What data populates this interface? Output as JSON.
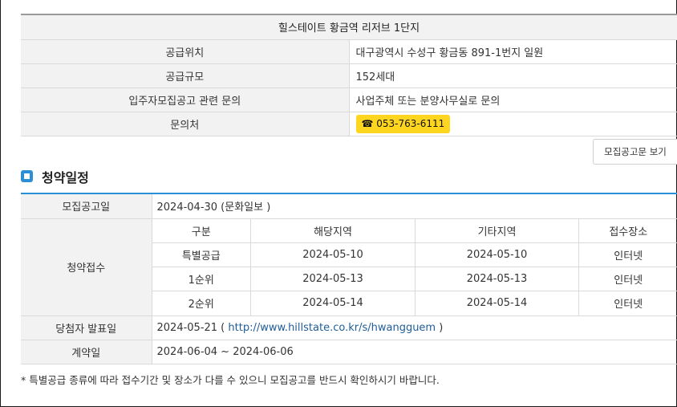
{
  "complex": {
    "title": "힐스테이트 황금역 리저브 1단지",
    "rows": [
      {
        "label": "공급위치",
        "value": "대구광역시 수성구 황금동 891-1번지 일원"
      },
      {
        "label": "공급규모",
        "value": "152세대"
      },
      {
        "label": "입주자모집공고 관련 문의",
        "value": "사업주체 또는 분양사무실로 문의"
      }
    ],
    "contact_label": "문의처",
    "phone": "☎ 053-763-6111"
  },
  "notice_button": "모집공고문 보기",
  "schedule": {
    "section_title": "청약일정",
    "announce_label": "모집공고일",
    "announce_value": "2024-04-30 (문화일보 )",
    "apply_label": "청약접수",
    "columns": [
      "구분",
      "해당지역",
      "기타지역",
      "접수장소"
    ],
    "rows": [
      [
        "특별공급",
        "2024-05-10",
        "2024-05-10",
        "인터넷"
      ],
      [
        "1순위",
        "2024-05-13",
        "2024-05-13",
        "인터넷"
      ],
      [
        "2순위",
        "2024-05-14",
        "2024-05-14",
        "인터넷"
      ]
    ],
    "winner_label": "당첨자 발표일",
    "winner_date": "2024-05-21 (",
    "winner_link": "http://www.hillstate.co.kr/s/hwangguem",
    "winner_close": ")",
    "contract_label": "계약일",
    "contract_value": "2024-06-04 ~ 2024-06-06"
  },
  "footnote": "* 특별공급 종류에 따라 접수기간 및 장소가 다를 수 있으니 모집공고를 반드시 확인하시기 바랍니다.",
  "colors": {
    "accent": "#2b8fd6",
    "phone_badge": "#ffd61f",
    "label_bg": "#f2f2f2",
    "link": "#1f5d9a"
  }
}
